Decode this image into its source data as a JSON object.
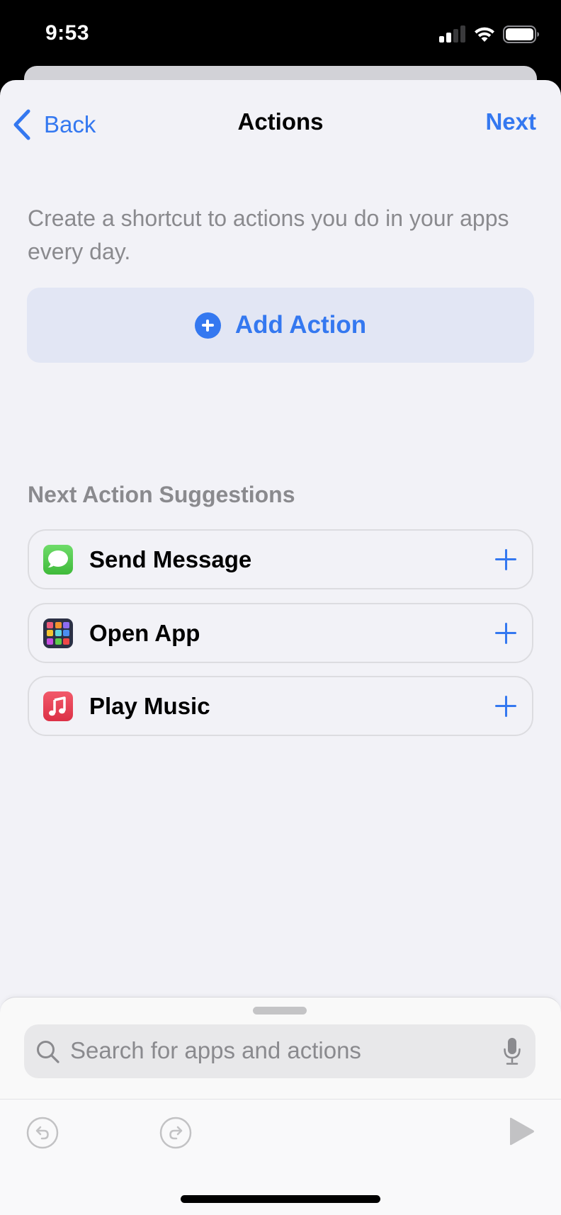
{
  "status_bar": {
    "time": "9:53",
    "signal_bars_active": 2,
    "signal_bars_total": 4,
    "wifi": "wifi-icon",
    "battery_level": 0.95
  },
  "nav": {
    "back_label": "Back",
    "title": "Actions",
    "next_label": "Next"
  },
  "description": "Create a shortcut to actions you do in your apps every day.",
  "add_action": {
    "label": "Add Action",
    "icon": "plus-circle-icon"
  },
  "suggestions": {
    "title": "Next Action Suggestions",
    "items": [
      {
        "label": "Send Message",
        "icon": "messages-app-icon"
      },
      {
        "label": "Open App",
        "icon": "open-app-icon"
      },
      {
        "label": "Play Music",
        "icon": "music-app-icon"
      }
    ]
  },
  "search": {
    "placeholder": "Search for apps and actions",
    "value": ""
  },
  "toolbar": {
    "undo": "undo-icon",
    "redo": "redo-icon",
    "run": "play-icon"
  },
  "colors": {
    "accent": "#3478f0",
    "background": "#f2f2f7",
    "add_action_bg": "#e2e6f4",
    "secondary_text": "#8a8a8e",
    "open_app_grid": [
      "#ec5a7a",
      "#f2922e",
      "#8e6cf2",
      "#f4c430",
      "#5fd4e0",
      "#4b8ef0",
      "#c54ee0",
      "#5ccc4a",
      "#ef4848"
    ]
  }
}
